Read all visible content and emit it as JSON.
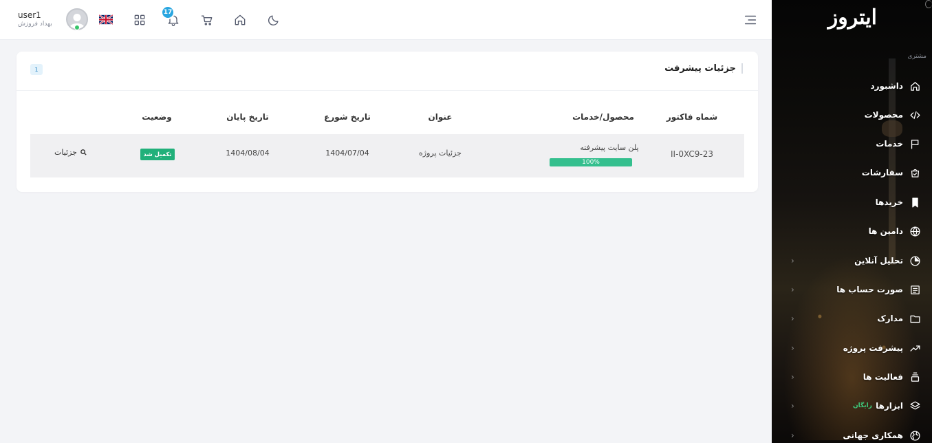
{
  "topbar": {
    "user": {
      "name": "user1",
      "role": "بهداد فروزش"
    },
    "notifications_count": "17"
  },
  "card": {
    "title": "جزئیات پیشرفت",
    "count": "1",
    "columns": [
      "شماه فاکتور",
      "محصول/خدمات",
      "عنوان",
      "تاریخ شورع",
      "تاریخ پایان",
      "وضعیت"
    ],
    "rows": [
      {
        "invoice": "II-0XC9-23",
        "product": "پلن سایت پیشرفته",
        "progress": "100%",
        "title": "جزئیات پروژه",
        "start_date": "1404/07/04",
        "end_date": "1404/08/04",
        "status": "تکمیل شد",
        "action": "جزئیات"
      }
    ]
  },
  "sidebar": {
    "logo": "ایتروز",
    "section": "مشتری",
    "items": [
      {
        "label": "داشبورد",
        "icon": "home-icon"
      },
      {
        "label": "محصولات",
        "icon": "code-icon"
      },
      {
        "label": "خدمات",
        "icon": "flag-icon"
      },
      {
        "label": "سفارشات",
        "icon": "bag-icon"
      },
      {
        "label": "خریدها",
        "icon": "bookmark-icon"
      },
      {
        "label": "دامین ها",
        "icon": "globe-icon"
      },
      {
        "label": "تحلیل آنلاین",
        "icon": "pie-chart-icon"
      },
      {
        "label": "صورت حساب ها",
        "icon": "receipt-icon"
      },
      {
        "label": "مدارک",
        "icon": "folder-icon"
      },
      {
        "label": "پیشرفت پروژه",
        "icon": "trend-icon"
      },
      {
        "label": "فعالیت ها",
        "icon": "stack-icon"
      },
      {
        "label": "ابزارها",
        "icon": "layers-icon",
        "badge": "رایگان"
      },
      {
        "label": "همکاری جهانی",
        "icon": "world-icon"
      }
    ]
  }
}
